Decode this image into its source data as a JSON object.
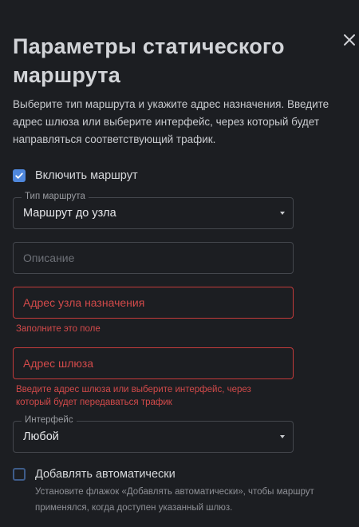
{
  "dialog": {
    "title": "Параметры статического маршрута",
    "description": "Выберите тип маршрута и укажите адрес назначения. Введите адрес шлюза или выберите интерфейс, через который будет направляться соответствующий трафик."
  },
  "enable_route": {
    "label": "Включить маршрут",
    "checked": true
  },
  "route_type": {
    "label": "Тип маршрута",
    "value": "Маршрут до узла"
  },
  "description_field": {
    "placeholder": "Описание"
  },
  "destination": {
    "placeholder": "Адрес узла назначения",
    "error": "Заполните это поле"
  },
  "gateway": {
    "placeholder": "Адрес шлюза",
    "error": "Введите адрес шлюза или выберите интерфейс, через который будет передаваться трафик"
  },
  "interface": {
    "label": "Интерфейс",
    "value": "Любой"
  },
  "auto_add": {
    "label": "Добавлять автоматически",
    "checked": false,
    "hint": "Установите флажок «Добавлять автоматически», чтобы маршрут применялся, когда доступен указанный шлюз."
  },
  "colors": {
    "accent": "#4f87dc",
    "error": "#d24a4a",
    "background": "#1c1e22"
  },
  "icons": {
    "close": "close-icon",
    "check": "checkmark-icon",
    "dropdown": "caret-down-icon"
  }
}
